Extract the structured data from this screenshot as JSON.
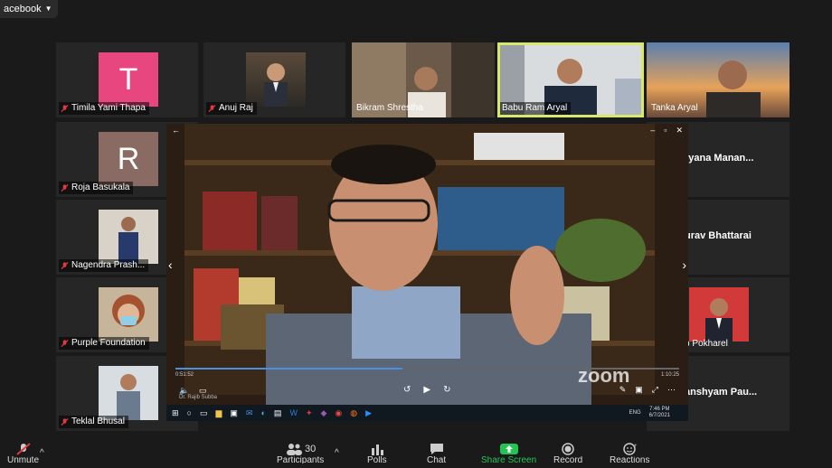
{
  "app": {
    "source_tag": "acebook"
  },
  "participants": [
    {
      "name": "Timila Yami Thapa",
      "avatar": "T",
      "color": "#e8467f"
    },
    {
      "name": "Anuj Raj"
    },
    {
      "name": "Bikram Shrestha"
    },
    {
      "name": "Babu Ram Aryal",
      "active": true
    },
    {
      "name": "Tanka Aryal"
    },
    {
      "name": "Roja Basukala",
      "avatar": "R",
      "color": "#8a6b63"
    },
    {
      "name": "Nagendra Prash..."
    },
    {
      "name": "Purple Foundation"
    },
    {
      "name": "Teklal Bhusal"
    }
  ],
  "partial_names": {
    "r1": "ryana  Manan...",
    "r2": "urav Bhattarai",
    "r3": "b Pokharel",
    "r4": "anshyam  Pau..."
  },
  "video": {
    "brand": "zoom",
    "watermark": "Dr. Rajib Subba",
    "time_current": "0:51:52",
    "time_total": "1:10:25",
    "progress": 0.45,
    "taskbar_time": "7:46 PM",
    "taskbar_date": "6/7/2021",
    "taskbar_lang": "ENG"
  },
  "toolbar": {
    "mute_label": "Unmute",
    "participants_label": "Participants",
    "participants_count": "30",
    "polls_label": "Polls",
    "chat_label": "Chat",
    "share_label": "Share Screen",
    "record_label": "Record",
    "reactions_label": "Reactions"
  },
  "colors": {
    "active_border": "#d7e86b",
    "share_green": "#23c552",
    "mute_red": "#e0393e"
  }
}
